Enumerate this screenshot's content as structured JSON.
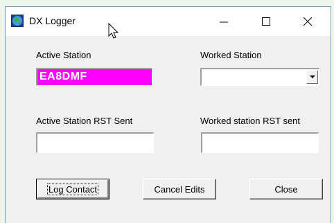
{
  "window": {
    "title": "DX Logger",
    "icon": "globe-app-icon",
    "controls": [
      "minimize",
      "maximize",
      "close"
    ]
  },
  "form": {
    "active_station_label": "Active Station",
    "active_station_value": "EA8DMF",
    "worked_station_label": "Worked Station",
    "worked_station_value": "",
    "active_rst_label": "Active Station RST Sent",
    "active_rst_value": "",
    "worked_rst_label": "Worked station RST sent",
    "worked_rst_value": ""
  },
  "buttons": {
    "log_contact": "Log Contact",
    "cancel_edits": "Cancel Edits",
    "close": "Close"
  },
  "colors": {
    "active_station_bg": "#ff00ff",
    "active_station_text": "#ffffff",
    "window_border": "#6c9ec4"
  }
}
